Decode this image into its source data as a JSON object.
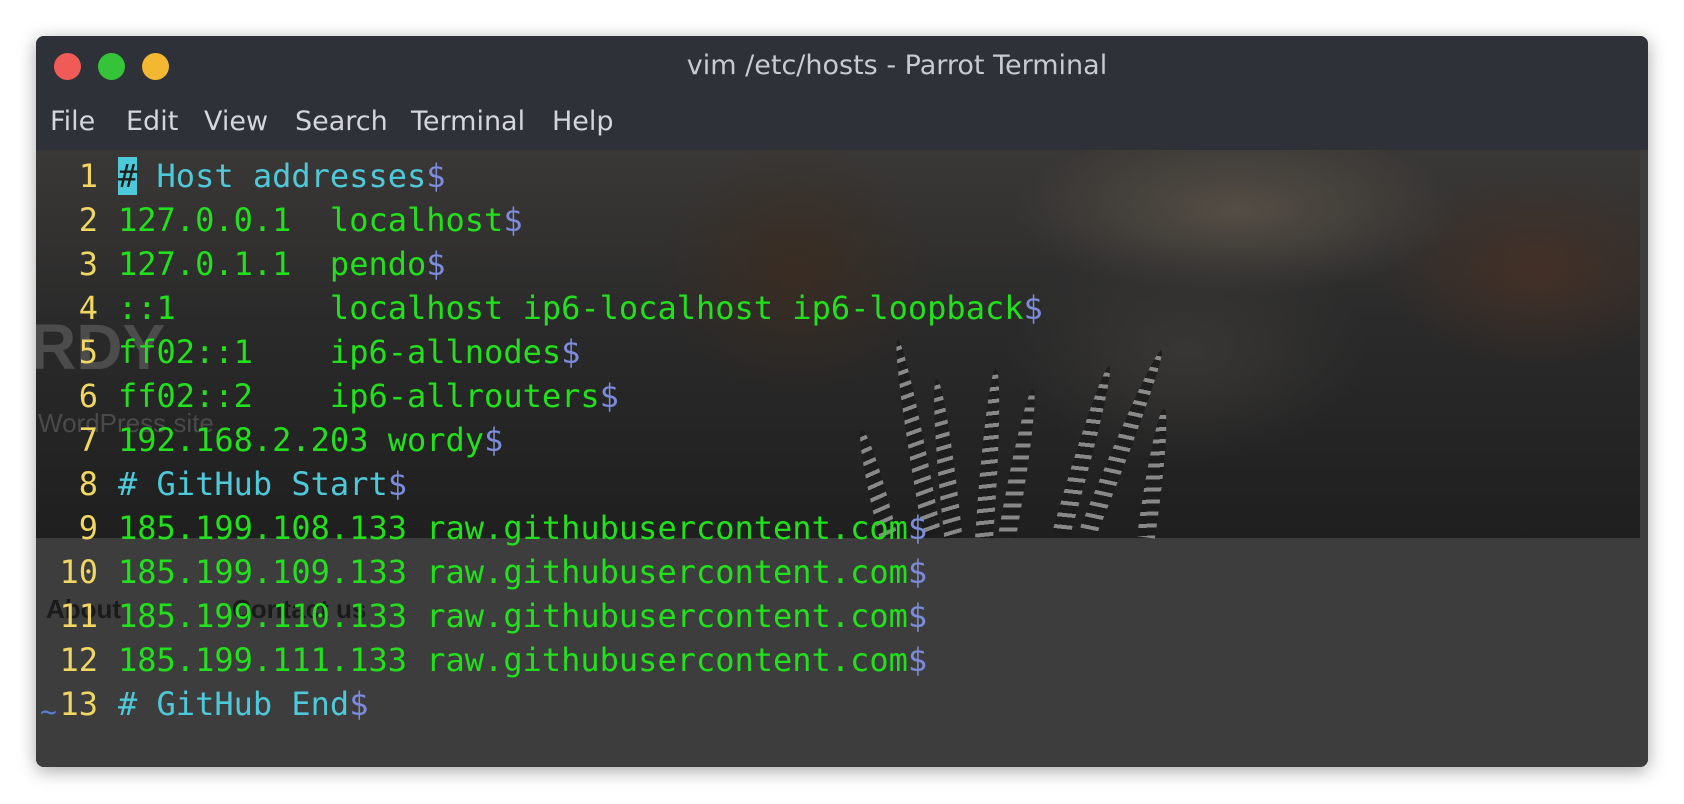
{
  "window": {
    "title": "vim /etc/hosts - Parrot Terminal"
  },
  "menu": [
    "File",
    "Edit",
    "View",
    "Search",
    "Terminal",
    "Help"
  ],
  "background_ghost_text": {
    "logo_fragment": "RDY",
    "tagline": "WordPress site",
    "nav_about": "About",
    "nav_contact": "Contact us"
  },
  "editor": {
    "eol_marker": "$",
    "tilde": "~",
    "lines": [
      {
        "num": "1",
        "text": "# Host addresses",
        "kind": "comment"
      },
      {
        "num": "2",
        "text": "127.0.0.1  localhost",
        "kind": "entry"
      },
      {
        "num": "3",
        "text": "127.0.1.1  pendo",
        "kind": "entry"
      },
      {
        "num": "4",
        "text": "::1        localhost ip6-localhost ip6-loopback",
        "kind": "entry"
      },
      {
        "num": "5",
        "text": "ff02::1    ip6-allnodes",
        "kind": "entry"
      },
      {
        "num": "6",
        "text": "ff02::2    ip6-allrouters",
        "kind": "entry"
      },
      {
        "num": "7",
        "text": "192.168.2.203 wordy",
        "kind": "entry"
      },
      {
        "num": "8",
        "text": "# GitHub Start",
        "kind": "comment"
      },
      {
        "num": "9",
        "text": "185.199.108.133 raw.githubusercontent.com",
        "kind": "entry"
      },
      {
        "num": "10",
        "text": "185.199.109.133 raw.githubusercontent.com",
        "kind": "entry"
      },
      {
        "num": "11",
        "text": "185.199.110.133 raw.githubusercontent.com",
        "kind": "entry"
      },
      {
        "num": "12",
        "text": "185.199.111.133 raw.githubusercontent.com",
        "kind": "entry"
      },
      {
        "num": "13",
        "text": "# GitHub End",
        "kind": "comment"
      }
    ]
  },
  "colors": {
    "line_number": "#f1d761",
    "entry_text": "#22e01c",
    "comment_text": "#4ec9d9",
    "eol_marker": "#7c8bdb",
    "cursor": "#4ec9d9",
    "close_button": "#f15b57",
    "maximize_button": "#35c33a",
    "minimize_button": "#f4b731"
  }
}
